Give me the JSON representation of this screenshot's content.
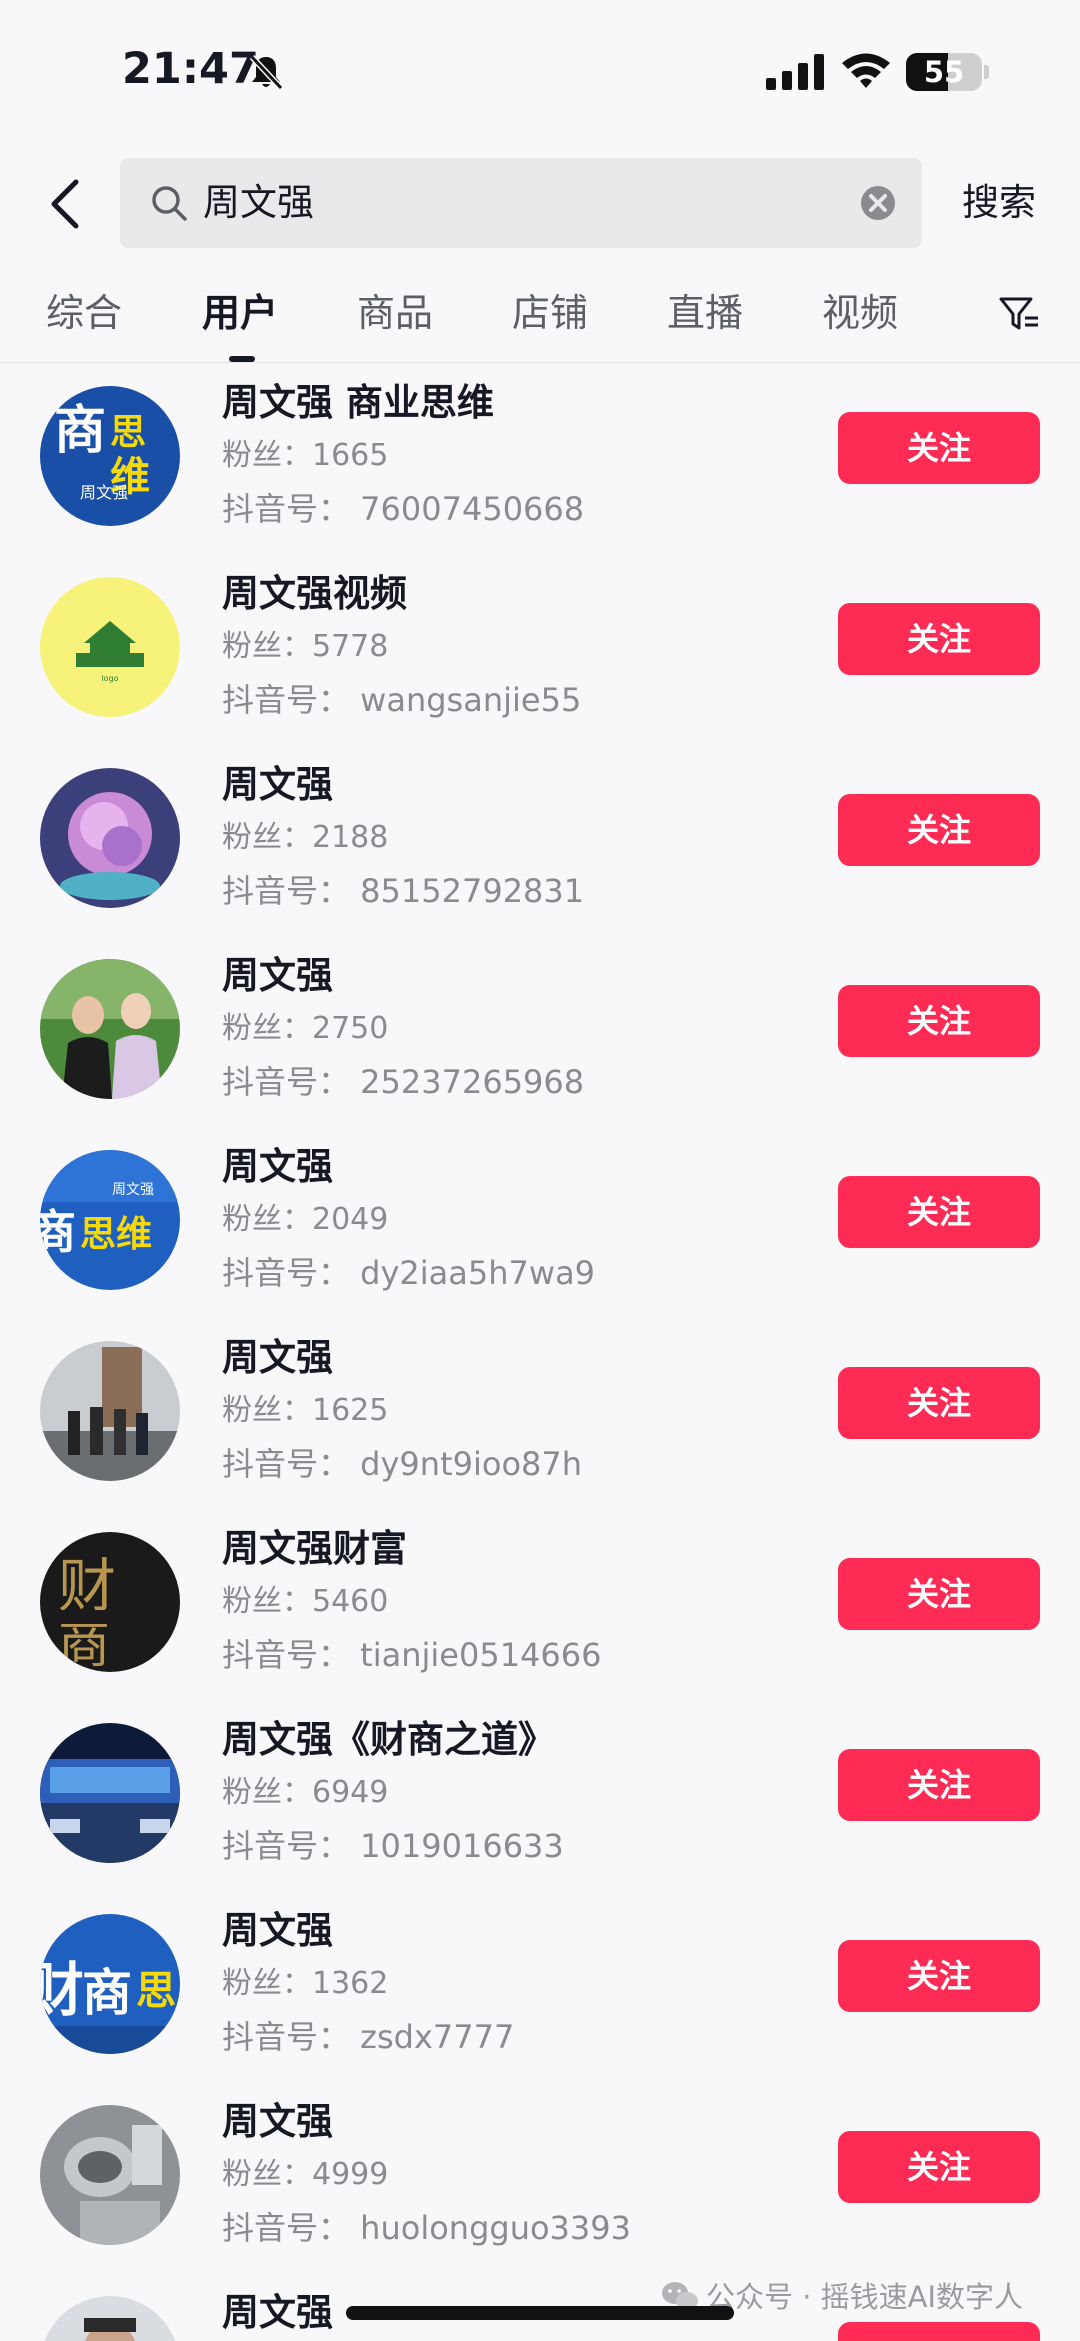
{
  "status_bar": {
    "time": "21:47",
    "battery": "55",
    "battery_level": 0.55
  },
  "search": {
    "query": "周文强",
    "button_label": "搜索"
  },
  "tabs": [
    {
      "label": "综合",
      "active": false
    },
    {
      "label": "用户",
      "active": true
    },
    {
      "label": "商品",
      "active": false
    },
    {
      "label": "店铺",
      "active": false
    },
    {
      "label": "直播",
      "active": false
    },
    {
      "label": "视频",
      "active": false
    }
  ],
  "users": [
    {
      "name": "周文强  商业思维",
      "fans": "粉丝：1665",
      "douyin_id": "抖音号： 76007450668",
      "follow_label": "关注",
      "avatar": "avatar-shang-siwei"
    },
    {
      "name": "周文强视频",
      "fans": "粉丝：5778",
      "douyin_id": "抖音号： wangsanjie55",
      "follow_label": "关注",
      "avatar": "avatar-yellow-logo"
    },
    {
      "name": "周文强",
      "fans": "粉丝：2188",
      "douyin_id": "抖音号： 85152792831",
      "follow_label": "关注",
      "avatar": "avatar-purple-rose"
    },
    {
      "name": "周文强",
      "fans": "粉丝：2750",
      "douyin_id": "抖音号： 25237265968",
      "follow_label": "关注",
      "avatar": "avatar-couple-photo"
    },
    {
      "name": "周文强",
      "fans": "粉丝：2049",
      "douyin_id": "抖音号： dy2iaa5h7wa9",
      "follow_label": "关注",
      "avatar": "avatar-siwei-blue"
    },
    {
      "name": "周文强",
      "fans": "粉丝：1625",
      "douyin_id": "抖音号： dy9nt9ioo87h",
      "follow_label": "关注",
      "avatar": "avatar-group-photo"
    },
    {
      "name": "周文强财富",
      "fans": "粉丝：5460",
      "douyin_id": "抖音号： tianjie0514666",
      "follow_label": "关注",
      "avatar": "avatar-caishang-dark"
    },
    {
      "name": "周文强《财商之道》",
      "fans": "粉丝：6949",
      "douyin_id": "抖音号： 1019016633",
      "follow_label": "关注",
      "avatar": "avatar-stage-event"
    },
    {
      "name": "周文强",
      "fans": "粉丝：1362",
      "douyin_id": "抖音号： zsdx7777",
      "follow_label": "关注",
      "avatar": "avatar-caishang-blue"
    },
    {
      "name": "周文强",
      "fans": "粉丝：4999",
      "douyin_id": "抖音号： huolongguo3393",
      "follow_label": "关注",
      "avatar": "avatar-kitchen-photo"
    },
    {
      "name": "周文强",
      "fans": "",
      "douyin_id": "",
      "follow_label": "关注",
      "avatar": "avatar-man-portrait"
    }
  ],
  "watermark": "公众号 · 摇钱速AI数字人",
  "colors": {
    "accent": "#fe2c55",
    "background": "#f8f8fa",
    "text": "#161823",
    "secondary_text": "#8a8b91"
  }
}
